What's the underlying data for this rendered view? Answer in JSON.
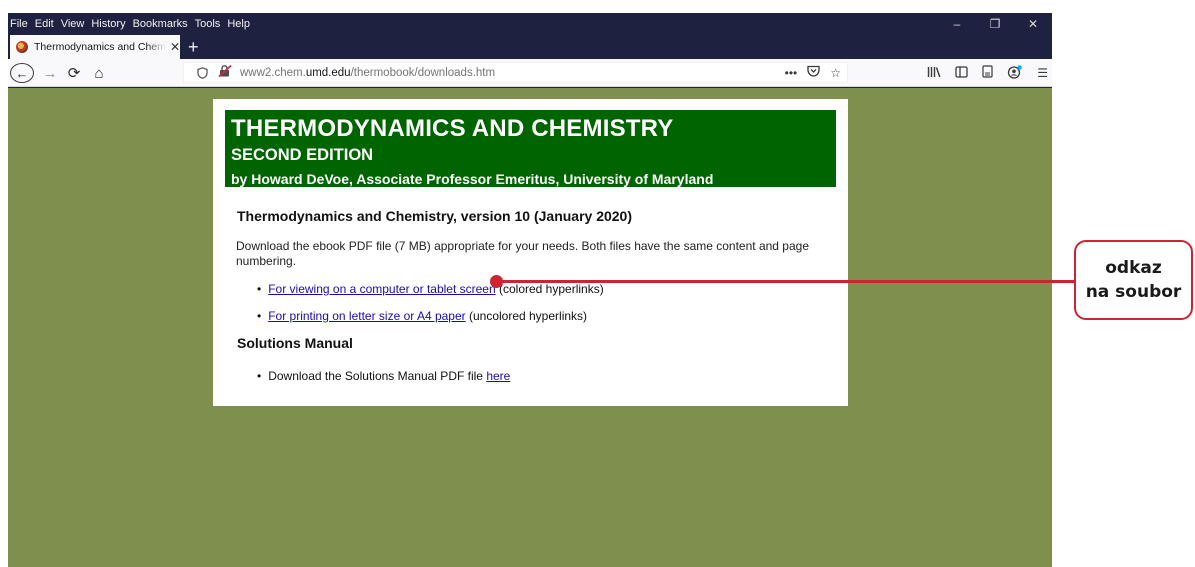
{
  "menubar": {
    "items": [
      "File",
      "Edit",
      "View",
      "History",
      "Bookmarks",
      "Tools",
      "Help"
    ],
    "window_controls": {
      "minimize": "–",
      "restore": "❐",
      "close": "✕"
    }
  },
  "tab": {
    "title": "Thermodynamics and Chemistry",
    "favicon": "umd-globe-icon",
    "close": "✕",
    "new_tab": "+"
  },
  "navbar": {
    "back": "←",
    "forward": "→",
    "reload": "⟳",
    "home": "⌂",
    "url_prefix": "www2.chem.",
    "url_domain": "umd.edu",
    "url_path": "/thermobook/downloads.htm",
    "page_actions": "•••",
    "pocket": "◡",
    "bookmark_star": "☆",
    "library": "|||\\",
    "sidebar": "◫",
    "reader": "▤",
    "account": "●",
    "menu": "☰"
  },
  "page": {
    "background_color": "#7e8f4e",
    "banner_color": "#006400",
    "banner": {
      "title": "THERMODYNAMICS AND CHEMISTRY",
      "edition": "SECOND EDITION",
      "author": "by Howard DeVoe, Associate Professor Emeritus, University of Maryland"
    },
    "version_heading": "Thermodynamics and Chemistry, version 10 (January 2020)",
    "download_text": "Download the ebook PDF file (7 MB) appropriate for your needs. Both files have the same content and page numbering.",
    "links": [
      {
        "link_text": "For viewing on a computer or tablet screen",
        "suffix": " (colored hyperlinks)"
      },
      {
        "link_text": "For printing on letter size or A4 paper",
        "suffix": " (uncolored hyperlinks)"
      }
    ],
    "solutions_heading": "Solutions Manual",
    "solutions_text": "Download the Solutions Manual PDF file ",
    "solutions_link": "here"
  },
  "annotation": {
    "color": "#cc2430",
    "line1": "odkaz",
    "line2": "na soubor"
  }
}
